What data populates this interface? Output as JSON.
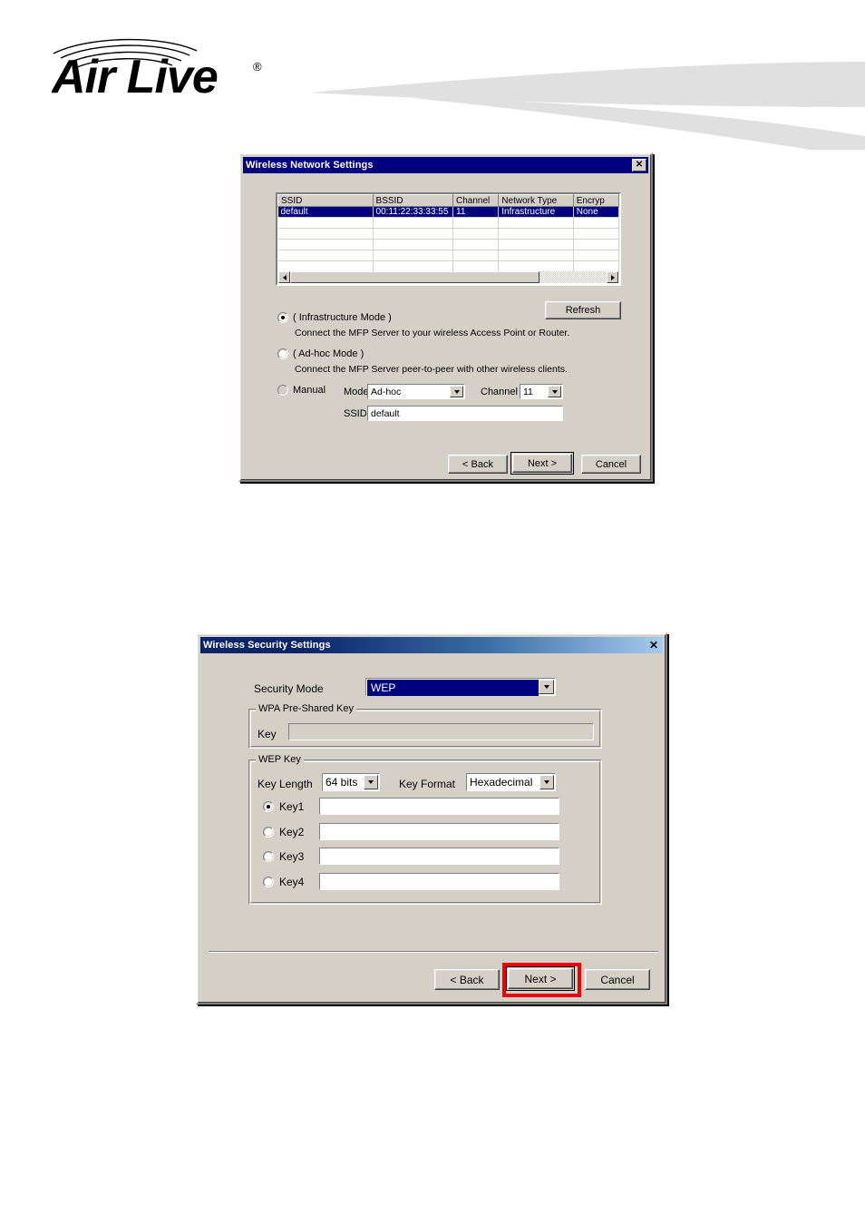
{
  "brand": {
    "logo_text": "Air Live",
    "logo_mark": "wifi-arcs",
    "registered": "®"
  },
  "dialog1": {
    "title": "Wireless Network Settings",
    "close_glyph": "✕",
    "network_table": {
      "columns": [
        "SSID",
        "BSSID",
        "Channel",
        "Network Type",
        "Encryp"
      ],
      "rows": [
        {
          "ssid": "default",
          "bssid": "00:11:22:33:33:55",
          "channel": "11",
          "network_type": "Infrastructure",
          "encryption": "None",
          "selected": true
        }
      ],
      "empty_row_count": 5,
      "scrollbar": {
        "left_arrow": "◄",
        "right_arrow": "►"
      }
    },
    "refresh_button": "Refresh",
    "modes": [
      {
        "id": "infrastructure",
        "label": "( Infrastructure Mode )",
        "description": "Connect the MFP Server to your wireless Access Point or Router.",
        "selected": true
      },
      {
        "id": "adhoc",
        "label": "( Ad-hoc Mode )",
        "description": "Connect the MFP Server peer-to-peer with other wireless clients.",
        "selected": false
      }
    ],
    "manual": {
      "label": "Manual",
      "selected": false,
      "mode_label": "Mode",
      "mode_value": "Ad-hoc",
      "channel_label": "Channel",
      "channel_value": "11",
      "ssid_label": "SSID",
      "ssid_value": "default"
    },
    "buttons": {
      "back": "< Back",
      "next": "Next >",
      "cancel": "Cancel",
      "default_button": "next"
    }
  },
  "dialog2": {
    "title": "Wireless Security Settings",
    "close_glyph": "✕",
    "security_mode": {
      "label": "Security Mode",
      "value": "WEP",
      "focused": true
    },
    "wpa_group": {
      "title": "WPA Pre-Shared Key",
      "key_label": "Key",
      "key_value": "",
      "key_disabled": true
    },
    "wep_group": {
      "title": "WEP Key",
      "key_length_label": "Key Length",
      "key_length_value": "64 bits",
      "key_format_label": "Key Format",
      "key_format_value": "Hexadecimal",
      "keys": [
        {
          "label": "Key1",
          "value": "",
          "selected": true
        },
        {
          "label": "Key2",
          "value": "",
          "selected": false
        },
        {
          "label": "Key3",
          "value": "",
          "selected": false
        },
        {
          "label": "Key4",
          "value": "",
          "selected": false
        }
      ]
    },
    "buttons": {
      "back": "< Back",
      "next": "Next >",
      "cancel": "Cancel",
      "default_button": "next",
      "highlighted_button": "next"
    }
  },
  "annotation": {
    "highlight_color": "#ee0000"
  }
}
